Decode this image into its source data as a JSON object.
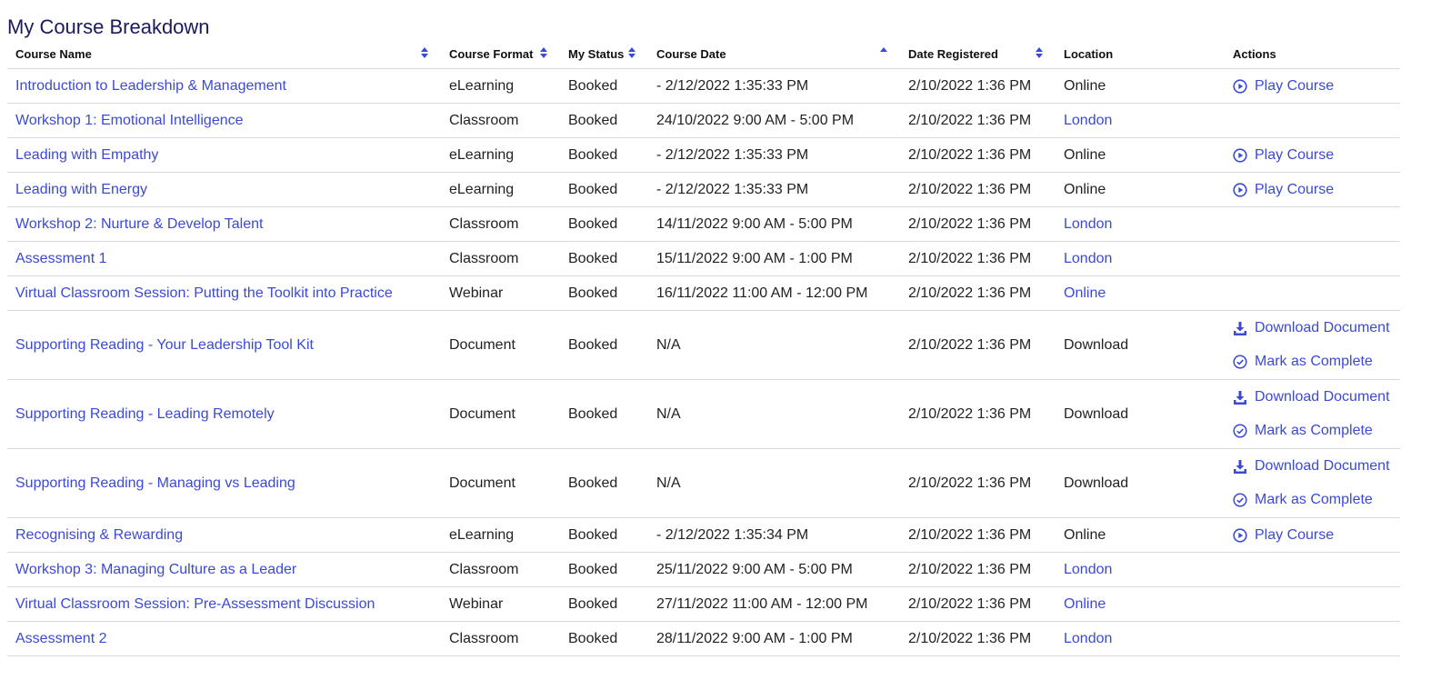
{
  "page": {
    "title": "My Course Breakdown"
  },
  "colors": {
    "link": "#3b4ad6",
    "title": "#1a1a5e",
    "sort": "#3b4ad6",
    "divider": "#d9d9d9"
  },
  "table": {
    "headers": {
      "course_name": "Course Name",
      "course_format": "Course Format",
      "my_status": "My Status",
      "course_date": "Course Date",
      "date_registered": "Date Registered",
      "location": "Location",
      "actions": "Actions"
    },
    "actions": {
      "play": {
        "label": "Play Course",
        "icon": "play-circle-icon"
      },
      "download": {
        "label": "Download Document",
        "icon": "download-icon"
      },
      "complete": {
        "label": "Mark as Complete",
        "icon": "check-circle-icon"
      }
    },
    "rows": [
      {
        "name": "Introduction to Leadership & Management",
        "format": "eLearning",
        "status": "Booked",
        "date": "- 2/12/2022 1:35:33 PM",
        "registered": "2/10/2022 1:36 PM",
        "location": "Online",
        "location_link": false,
        "actions": [
          "play"
        ]
      },
      {
        "name": "Workshop 1: Emotional Intelligence",
        "format": "Classroom",
        "status": "Booked",
        "date": "24/10/2022 9:00 AM - 5:00 PM",
        "registered": "2/10/2022 1:36 PM",
        "location": "London",
        "location_link": true,
        "actions": []
      },
      {
        "name": "Leading with Empathy",
        "format": "eLearning",
        "status": "Booked",
        "date": "- 2/12/2022 1:35:33 PM",
        "registered": "2/10/2022 1:36 PM",
        "location": "Online",
        "location_link": false,
        "actions": [
          "play"
        ]
      },
      {
        "name": "Leading with Energy",
        "format": "eLearning",
        "status": "Booked",
        "date": "- 2/12/2022 1:35:33 PM",
        "registered": "2/10/2022 1:36 PM",
        "location": "Online",
        "location_link": false,
        "actions": [
          "play"
        ]
      },
      {
        "name": "Workshop 2: Nurture & Develop Talent",
        "format": "Classroom",
        "status": "Booked",
        "date": "14/11/2022 9:00 AM - 5:00 PM",
        "registered": "2/10/2022 1:36 PM",
        "location": "London",
        "location_link": true,
        "actions": []
      },
      {
        "name": "Assessment 1",
        "format": "Classroom",
        "status": "Booked",
        "date": "15/11/2022 9:00 AM - 1:00 PM",
        "registered": "2/10/2022 1:36 PM",
        "location": "London",
        "location_link": true,
        "actions": []
      },
      {
        "name": "Virtual Classroom Session: Putting the Toolkit into Practice",
        "format": "Webinar",
        "status": "Booked",
        "date": "16/11/2022 11:00 AM - 12:00 PM",
        "registered": "2/10/2022 1:36 PM",
        "location": "Online",
        "location_link": true,
        "actions": []
      },
      {
        "name": "Supporting Reading - Your Leadership Tool Kit",
        "format": "Document",
        "status": "Booked",
        "date": "N/A",
        "registered": "2/10/2022 1:36 PM",
        "location": "Download",
        "location_link": false,
        "actions": [
          "download",
          "complete"
        ]
      },
      {
        "name": "Supporting Reading - Leading Remotely",
        "format": "Document",
        "status": "Booked",
        "date": "N/A",
        "registered": "2/10/2022 1:36 PM",
        "location": "Download",
        "location_link": false,
        "actions": [
          "download",
          "complete"
        ]
      },
      {
        "name": "Supporting Reading - Managing vs Leading",
        "format": "Document",
        "status": "Booked",
        "date": "N/A",
        "registered": "2/10/2022 1:36 PM",
        "location": "Download",
        "location_link": false,
        "actions": [
          "download",
          "complete"
        ]
      },
      {
        "name": "Recognising & Rewarding",
        "format": "eLearning",
        "status": "Booked",
        "date": "- 2/12/2022 1:35:34 PM",
        "registered": "2/10/2022 1:36 PM",
        "location": "Online",
        "location_link": false,
        "actions": [
          "play"
        ]
      },
      {
        "name": "Workshop 3: Managing Culture as a Leader",
        "format": "Classroom",
        "status": "Booked",
        "date": "25/11/2022 9:00 AM - 5:00 PM",
        "registered": "2/10/2022 1:36 PM",
        "location": "London",
        "location_link": true,
        "actions": []
      },
      {
        "name": "Virtual Classroom Session: Pre-Assessment Discussion",
        "format": "Webinar",
        "status": "Booked",
        "date": "27/11/2022 11:00 AM - 12:00 PM",
        "registered": "2/10/2022 1:36 PM",
        "location": "Online",
        "location_link": true,
        "actions": []
      },
      {
        "name": "Assessment 2",
        "format": "Classroom",
        "status": "Booked",
        "date": "28/11/2022 9:00 AM - 1:00 PM",
        "registered": "2/10/2022 1:36 PM",
        "location": "London",
        "location_link": true,
        "actions": []
      }
    ]
  }
}
